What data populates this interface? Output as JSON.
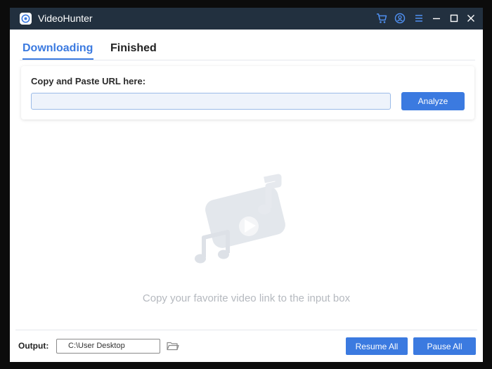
{
  "app": {
    "title": "VideoHunter"
  },
  "titlebar": {
    "icons": [
      "cart-icon",
      "user-icon",
      "menu-icon",
      "minimize-icon",
      "maximize-icon",
      "close-icon"
    ]
  },
  "tabs": [
    {
      "label": "Downloading",
      "active": true
    },
    {
      "label": "Finished",
      "active": false
    }
  ],
  "url_box": {
    "label": "Copy and Paste URL here:",
    "value": "",
    "button_label": "Analyze"
  },
  "empty_state": {
    "message": "Copy your favorite video link to the input box",
    "icon": "video-music-note-icon"
  },
  "output": {
    "label": "Output:",
    "path": "C:\\User Desktop",
    "folder_icon": "folder-icon"
  },
  "actions": {
    "resume_label": "Resume All",
    "pause_label": "Pause All"
  },
  "colors": {
    "accent": "#3b7ae0",
    "titlebar": "#22303f",
    "muted_text": "#b5b9bf"
  }
}
